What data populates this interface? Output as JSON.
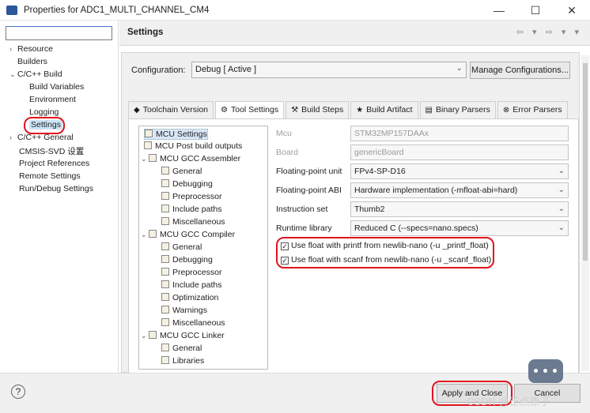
{
  "window": {
    "title": "Properties for ADC1_MULTI_CHANNEL_CM4"
  },
  "left_tree": {
    "filter_value": "",
    "items": [
      {
        "label": "Resource",
        "twisty": "›"
      },
      {
        "label": "Builders",
        "twisty": ""
      },
      {
        "label": "C/C++ Build",
        "twisty": "⌄"
      },
      {
        "label": "Build Variables",
        "twisty": ""
      },
      {
        "label": "Environment",
        "twisty": ""
      },
      {
        "label": "Logging",
        "twisty": ""
      },
      {
        "label": "Settings",
        "twisty": ""
      },
      {
        "label": "C/C++ General",
        "twisty": "›"
      },
      {
        "label": "CMSIS-SVD 设置",
        "twisty": ""
      },
      {
        "label": "Project References",
        "twisty": ""
      },
      {
        "label": "Remote Settings",
        "twisty": ""
      },
      {
        "label": "Run/Debug Settings",
        "twisty": ""
      }
    ]
  },
  "header": {
    "title": "Settings"
  },
  "configuration": {
    "label": "Configuration:",
    "value": "Debug  [ Active ]",
    "manage_button": "Manage Configurations..."
  },
  "tabs": [
    {
      "label": "Toolchain  Version",
      "icon": "◆"
    },
    {
      "label": "Tool Settings",
      "icon": "⚙"
    },
    {
      "label": "Build Steps",
      "icon": "⚒"
    },
    {
      "label": "Build Artifact",
      "icon": "★"
    },
    {
      "label": "Binary Parsers",
      "icon": "▤"
    },
    {
      "label": "Error Parsers",
      "icon": "⊗"
    }
  ],
  "settings_tree": [
    {
      "label": "MCU Settings",
      "twisty": ""
    },
    {
      "label": "MCU Post build outputs",
      "twisty": ""
    },
    {
      "label": "MCU GCC Assembler",
      "twisty": "⌄"
    },
    {
      "label": "General",
      "twisty": ""
    },
    {
      "label": "Debugging",
      "twisty": ""
    },
    {
      "label": "Preprocessor",
      "twisty": ""
    },
    {
      "label": "Include paths",
      "twisty": ""
    },
    {
      "label": "Miscellaneous",
      "twisty": ""
    },
    {
      "label": "MCU GCC Compiler",
      "twisty": "⌄"
    },
    {
      "label": "General",
      "twisty": ""
    },
    {
      "label": "Debugging",
      "twisty": ""
    },
    {
      "label": "Preprocessor",
      "twisty": ""
    },
    {
      "label": "Include paths",
      "twisty": ""
    },
    {
      "label": "Optimization",
      "twisty": ""
    },
    {
      "label": "Warnings",
      "twisty": ""
    },
    {
      "label": "Miscellaneous",
      "twisty": ""
    },
    {
      "label": "MCU GCC Linker",
      "twisty": "⌄"
    },
    {
      "label": "General",
      "twisty": ""
    },
    {
      "label": "Libraries",
      "twisty": ""
    }
  ],
  "mcu_props": {
    "mcu_label": "Mcu",
    "mcu_value": "STM32MP157DAAx",
    "board_label": "Board",
    "board_value": "genericBoard",
    "fpu_label": "Floating-point unit",
    "fpu_value": "FPv4-SP-D16",
    "abi_label": "Floating-point ABI",
    "abi_value": "Hardware implementation (-mfloat-abi=hard)",
    "iset_label": "Instruction set",
    "iset_value": "Thumb2",
    "rtlib_label": "Runtime library",
    "rtlib_value": "Reduced C (--specs=nano.specs)",
    "printf_float": "Use float with printf from newlib-nano (-u _printf_float)",
    "scanf_float": "Use float with scanf from newlib-nano (-u _scanf_float)",
    "check_mark": "✓"
  },
  "bottom": {
    "help": "?",
    "apply_close": "Apply and Close",
    "cancel": "Cancel"
  },
  "watermark": "CSDN @正点原子"
}
